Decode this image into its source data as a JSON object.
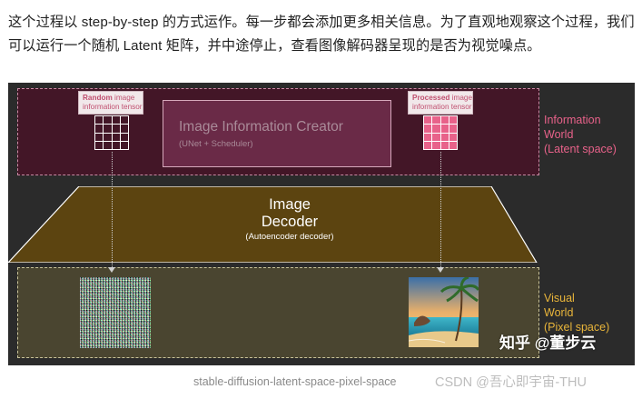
{
  "article": {
    "paragraph": "这个过程以 step-by-step 的方式运作。每一步都会添加更多相关信息。为了直观地观察这个过程，我们可以运行一个随机 Latent 矩阵，并中途停止，查看图像解码器呈现的是否为视觉噪点。"
  },
  "figure": {
    "random_tag": {
      "bold": "Random",
      "rest_line1": " image",
      "line2": "information tensor"
    },
    "processed_tag": {
      "bold": "Processed",
      "rest_line1": " image",
      "line2": "information tensor"
    },
    "creator": {
      "title": "Image Information Creator",
      "subtitle": "(UNet + Scheduler)"
    },
    "decoder": {
      "title_line1": "Image",
      "title_line2": "Decoder",
      "subtitle": "(Autoencoder decoder)"
    },
    "info_label": {
      "line1": "Information",
      "line2": "World",
      "line3": "(Latent space)"
    },
    "visual_label": {
      "line1": "Visual",
      "line2": "World",
      "line3": "(Pixel space)"
    },
    "watermark": "知乎 @董步云",
    "colors": {
      "latent_band": "#431627",
      "pixel_band": "#4a4530",
      "decoder": "#5c4410",
      "info_accent": "#e8628a",
      "visual_accent": "#e9b53a"
    }
  },
  "caption": "stable-diffusion-latent-space-pixel-space",
  "csdn_watermark": "CSDN @吾心即宇宙-THU"
}
